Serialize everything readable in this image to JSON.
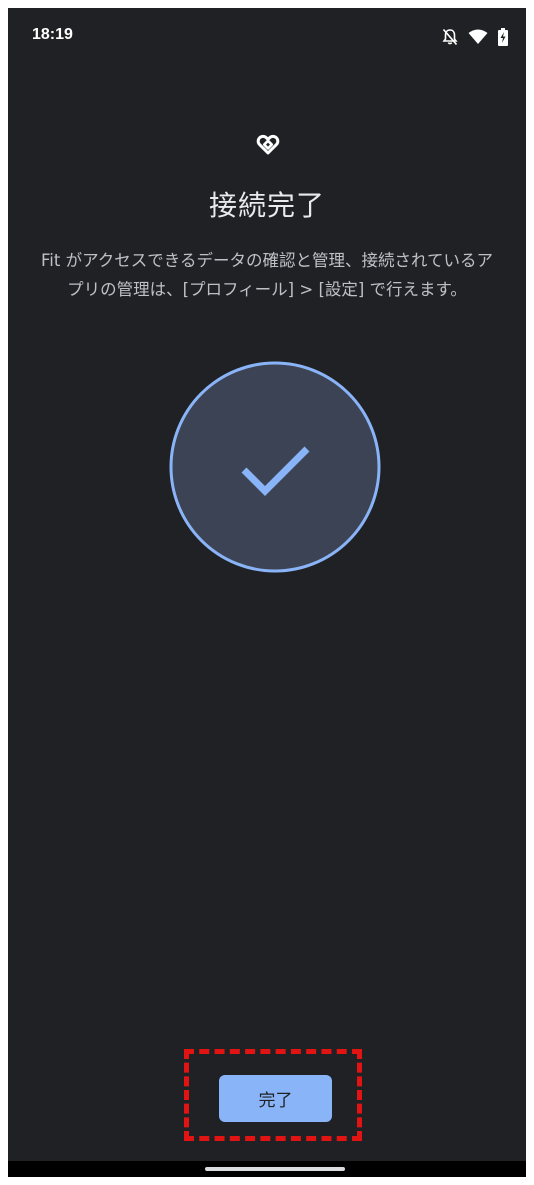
{
  "status_bar": {
    "time": "18:19",
    "icons": [
      "notifications-off-icon",
      "wifi-icon",
      "battery-charging-icon"
    ]
  },
  "app": {
    "logo_icon": "google-fit-icon",
    "brand_color": "#8ab4f8"
  },
  "content": {
    "title": "接続完了",
    "description": "Fit がアクセスできるデータの確認と管理、接続されているアプリの管理は、[プロフィール] > [設定] で行えます。",
    "status_icon": "check-icon"
  },
  "actions": {
    "done_label": "完了"
  }
}
